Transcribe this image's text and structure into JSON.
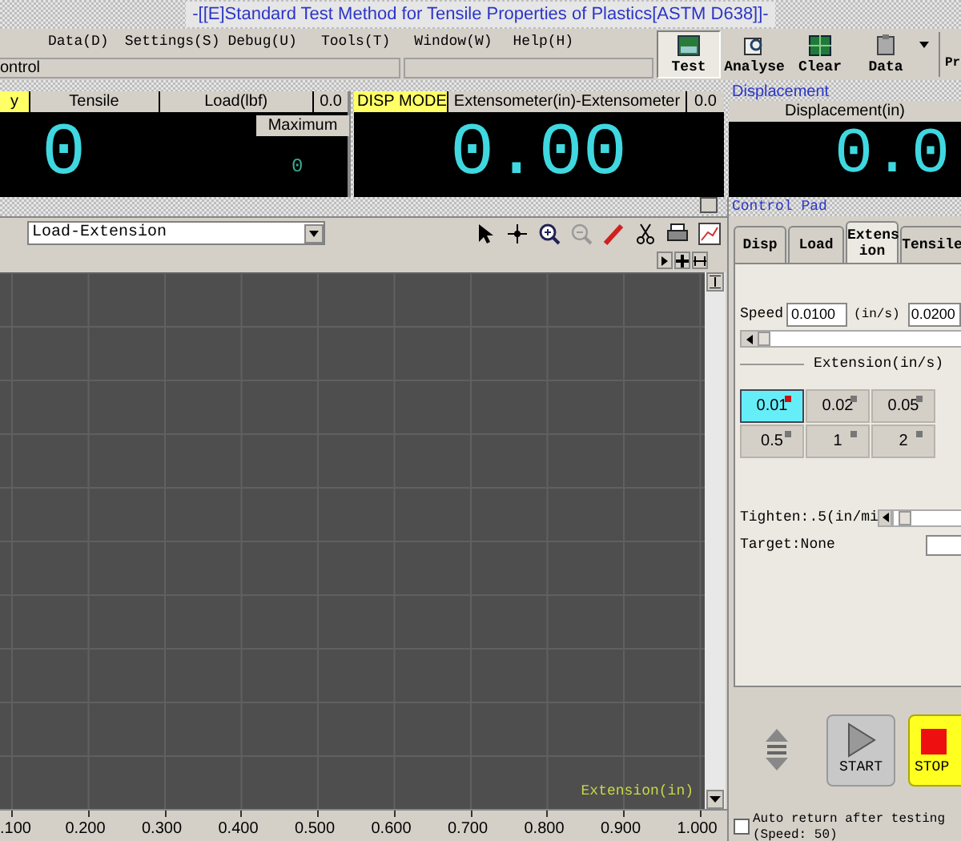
{
  "window": {
    "title": "-[[E]Standard Test Method for Tensile Properties of Plastics[ASTM D638]]-"
  },
  "menu": [
    "Data(D)",
    "Settings(S)",
    "Debug(U)",
    "Tools(T)",
    "Window(W)",
    "Help(H)"
  ],
  "toolbar": [
    {
      "label": "Test",
      "kind": "test",
      "selected": true
    },
    {
      "label": "Analyse",
      "kind": "analyse",
      "selected": false
    },
    {
      "label": "Clear",
      "kind": "clear",
      "selected": false
    },
    {
      "label": "Data",
      "kind": "data",
      "selected": false
    }
  ],
  "toolbar_cut": "Pr",
  "status_field": "ontrol",
  "displays": [
    {
      "mode": "y",
      "header": "Tensile",
      "channel": "Load(lbf)",
      "small": "0.0",
      "value": "0",
      "maximum_button": "Maximum",
      "maximum": "0"
    },
    {
      "mode": "DISP MODE",
      "header": "Extensometer(in)-Extensometer",
      "small": "0.0",
      "value": "0.00"
    },
    {
      "title": "Displacement",
      "header": "Displacement(in)",
      "value": "0.0"
    }
  ],
  "chart": {
    "view": "Load-Extension",
    "x_label": "Extension(in)",
    "x_ticks": [
      ".100",
      "0.200",
      "0.300",
      "0.400",
      "0.500",
      "0.600",
      "0.700",
      "0.800",
      "0.900",
      "1.000"
    ]
  },
  "control_pad": {
    "title": "Control Pad",
    "tabs": [
      {
        "label": "Disp",
        "selected": false
      },
      {
        "label": "Load",
        "selected": false
      },
      {
        "label": "Extens ion",
        "selected": true
      },
      {
        "label": "Tensile",
        "selected": false
      }
    ],
    "speed_label": "Speed",
    "speed": "0.0100",
    "unit": "(in/s)",
    "speed_2": "0.0200",
    "section": "Extension(in/s)",
    "rates": [
      {
        "label": "0.01",
        "selected": true
      },
      {
        "label": "0.02",
        "selected": false
      },
      {
        "label": "0.05",
        "selected": false
      },
      {
        "label": "0.5",
        "selected": false
      },
      {
        "label": "1",
        "selected": false
      },
      {
        "label": "2",
        "selected": false
      }
    ],
    "tighten": {
      "label": "Tighten:.5(in/mi",
      "level": 0.05
    },
    "target": "Target:None",
    "start": "START",
    "stop": "STOP",
    "auto_return": {
      "label": "Auto return after testing (Speed: 50)",
      "checked": false
    }
  }
}
